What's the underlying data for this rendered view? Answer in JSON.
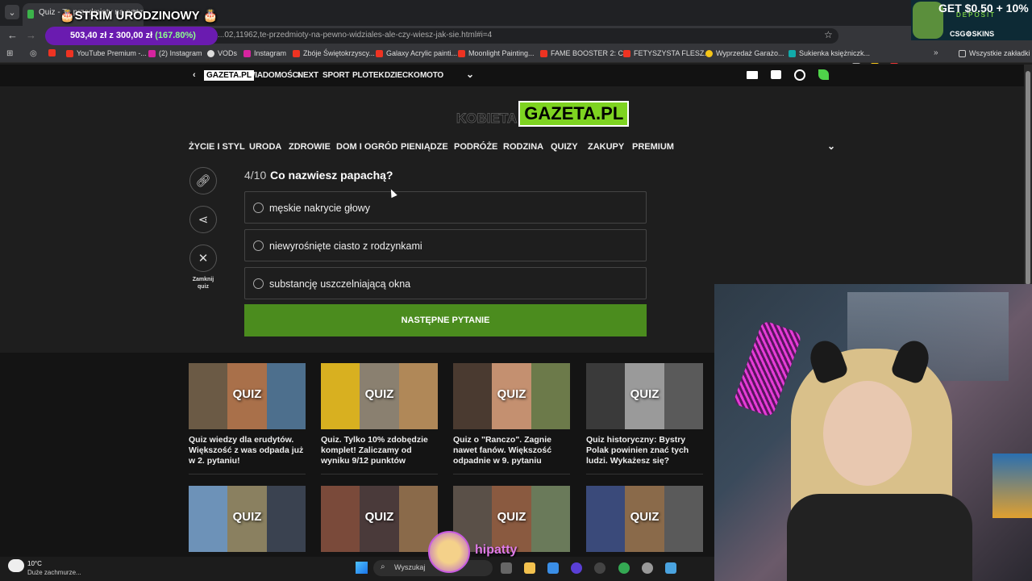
{
  "browser": {
    "tab_title": "Quiz - Te przedmioty na pewno",
    "stream_title": "🎂STRIM URODZINOWY 🎂",
    "url": "...02,11962,te-przedmioty-na-pewno-widziales-ale-czy-wiesz-jak-sie.html#i=4",
    "donation": {
      "amount": "503,40 zł z 300,00 zł",
      "percent": "(167.80%)"
    },
    "bookmarks": [
      "YouTube Premium -...",
      "(2) Instagram",
      "VODs",
      "Instagram",
      "Zbóje Świętokrzyscy...",
      "Galaxy Acrylic painti...",
      "Moonlight Painting...",
      "FAME BOOSTER 2: C...",
      "FETYSZYSTA FLESZ...",
      "Wyprzedaż Garażo...",
      "Sukienka księżniczk..."
    ],
    "all_bookmarks": "Wszystkie zakładki"
  },
  "ad": {
    "line1": "GET $0.50 + 10%",
    "line2": "DEPOSIT",
    "brand": "CSG⚙SKINS"
  },
  "gazeta_nav": {
    "logo": "GAZETA.PL",
    "items": [
      "WIADOMOŚCI",
      "NEXT",
      "SPORT",
      "PLOTEK",
      "DZIECKO",
      "MOTO"
    ]
  },
  "logo": {
    "kobieta": "KOBIETA",
    "gazeta": "GAZETA.PL"
  },
  "categories": [
    "ŻYCIE I STYL",
    "URODA",
    "ZDROWIE",
    "DOM I OGRÓD",
    "PIENIĄDZE",
    "PODRÓŻE",
    "RODZINA",
    "QUIZY",
    "ZAKUPY",
    "PREMIUM"
  ],
  "quiz": {
    "progress": "4/10",
    "question": "Co nazwiesz papachą?",
    "answers": [
      "męskie nakrycie głowy",
      "niewyrośnięte ciasto z rodzynkami",
      "substancję uszczelniającą okna"
    ],
    "next_label": "NASTĘPNE PYTANIE",
    "close_label": "Zamknij quiz"
  },
  "cards": [
    {
      "badge": "QUIZ",
      "title": "Quiz wiedzy dla erudytów. Większość z was odpada już w 2. pytaniu!",
      "colors": [
        "#6b5a45",
        "#a9704a",
        "#4d6f8d"
      ]
    },
    {
      "badge": "QUIZ",
      "title": "Quiz. Tylko 10% zdobędzie komplet! Zaliczamy od wyniku 9/12 punktów",
      "colors": [
        "#d8b020",
        "#8a8070",
        "#b08858"
      ]
    },
    {
      "badge": "QUIZ",
      "title": "Quiz o \"Ranczo\". Zagnie nawet fanów. Większość odpadnie w 9. pytaniu",
      "colors": [
        "#4a3a30",
        "#c49070",
        "#6c7a4a"
      ]
    },
    {
      "badge": "QUIZ",
      "title": "Quiz historyczny: Bystry Polak powinien znać tych ludzi. Wykażesz się?",
      "colors": [
        "#3a3a3a",
        "#9a9a9a",
        "#5a5a5a"
      ]
    },
    {
      "badge": "QUIZ",
      "title": "",
      "colors": [
        "#6d92b8",
        "#8a8060",
        "#3a4250"
      ]
    },
    {
      "badge": "QUIZ",
      "title": "",
      "colors": [
        "#7a4a3a",
        "#4a3a3a",
        "#8a6a4a"
      ]
    },
    {
      "badge": "QUIZ",
      "title": "",
      "colors": [
        "#5a5048",
        "#8a5a40",
        "#6a7a5a"
      ]
    },
    {
      "badge": "QUIZ",
      "title": "",
      "colors": [
        "#3a4a7a",
        "#8a6a4a",
        "#5a5a5a"
      ]
    }
  ],
  "taskbar": {
    "temp": "10°C",
    "weather": "Duże zachmurze...",
    "search": "Wyszukaj",
    "streamer": "hipatty"
  }
}
